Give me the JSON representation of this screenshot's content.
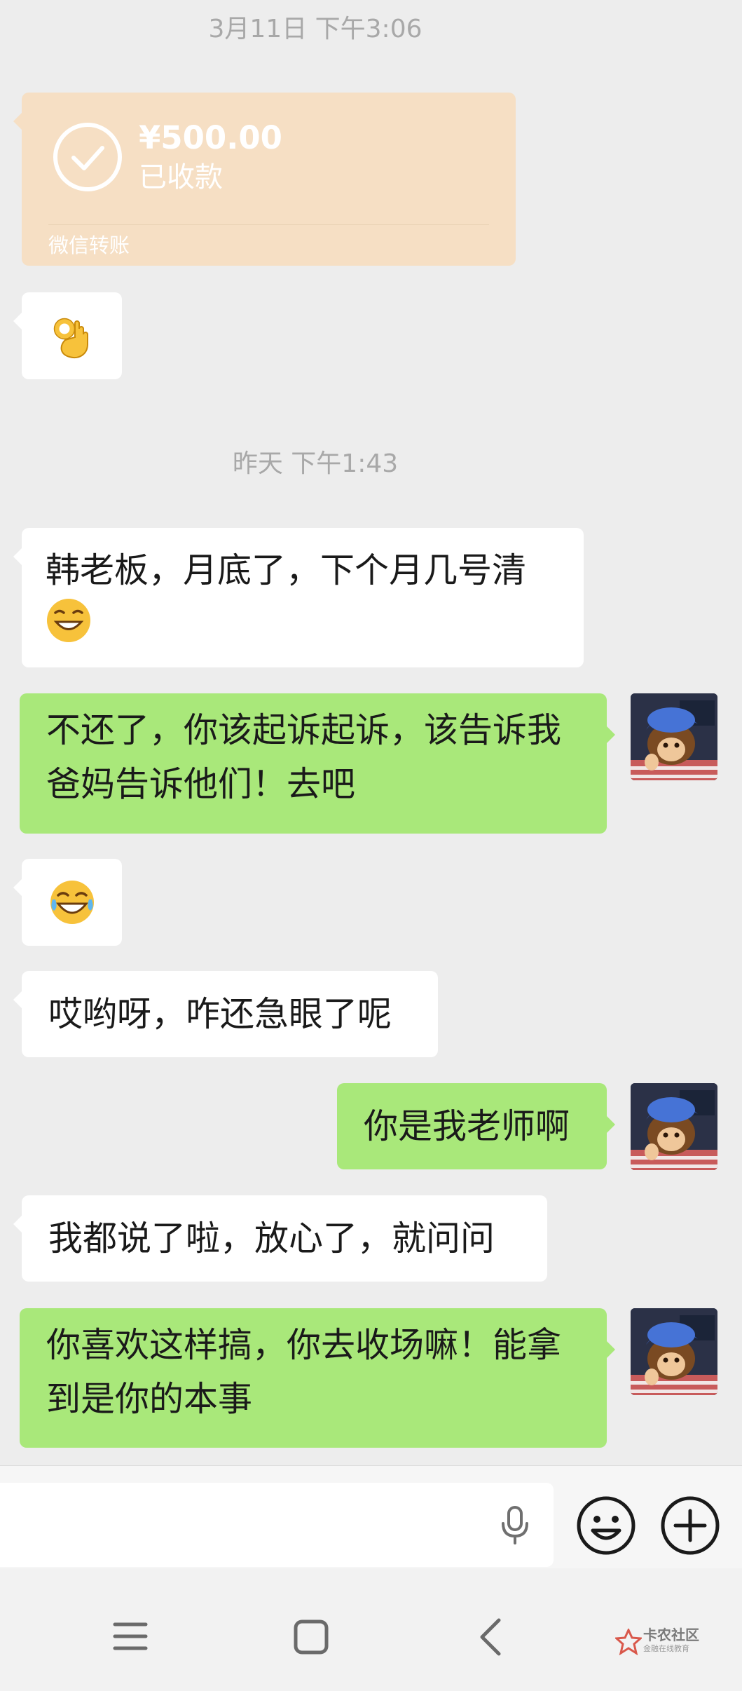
{
  "timestamps": {
    "first": "3月11日 下午3:06",
    "second": "昨天 下午1:43"
  },
  "transfer": {
    "amount": "¥500.00",
    "status": "已收款",
    "source": "微信转账"
  },
  "messages": {
    "m1": "韩老板，月底了，下个月几号清",
    "m2_line1": "不还了，你该起诉起诉，该告诉我",
    "m2_line2": "爸妈告诉他们！去吧",
    "m3": "哎哟呀，咋还急眼了呢",
    "m4": "你是我老师啊",
    "m5": "我都说了啦，放心了，就问问",
    "m6_line1": "你喜欢这样搞，你去收场嘛！能拿",
    "m6_line2": "到是你的本事"
  },
  "watermark": {
    "title": "卡农社区",
    "subtitle": "金融在线教育"
  },
  "colors": {
    "own_bubble": "#a9e87a",
    "other_bubble": "#ffffff",
    "transfer_bg": "#f6dfc4",
    "background": "#ededed"
  }
}
